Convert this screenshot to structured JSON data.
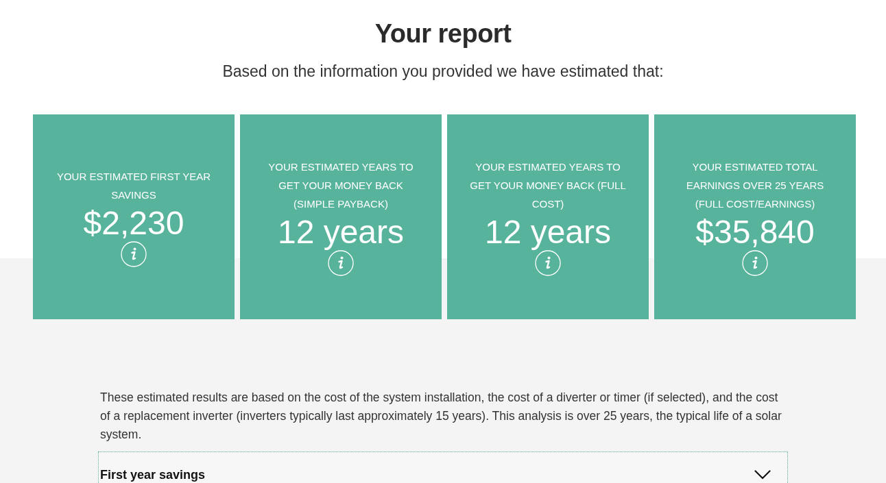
{
  "header": {
    "title": "Your report",
    "subtitle": "Based on the information you provided we have estimated that:"
  },
  "cards": [
    {
      "label": "YOUR ESTIMATED FIRST YEAR SAVINGS",
      "value": "$2,230"
    },
    {
      "label": "YOUR ESTIMATED YEARS TO GET YOUR MONEY BACK (SIMPLE PAYBACK)",
      "value": "12 years"
    },
    {
      "label": "YOUR ESTIMATED YEARS TO GET YOUR MONEY BACK (FULL COST)",
      "value": "12 years"
    },
    {
      "label": "YOUR ESTIMATED TOTAL EARNINGS OVER 25 YEARS (FULL COST/EARNINGS)",
      "value": "$35,840"
    }
  ],
  "note": "These estimated results are based on the cost of the system installation, the cost of a diverter or timer (if selected), and the cost of a replacement inverter (inverters typically last approximately 15 years). This analysis is over 25 years, the typical life of a solar system.",
  "accordion": [
    {
      "title": "First year savings",
      "expanded": false
    }
  ]
}
